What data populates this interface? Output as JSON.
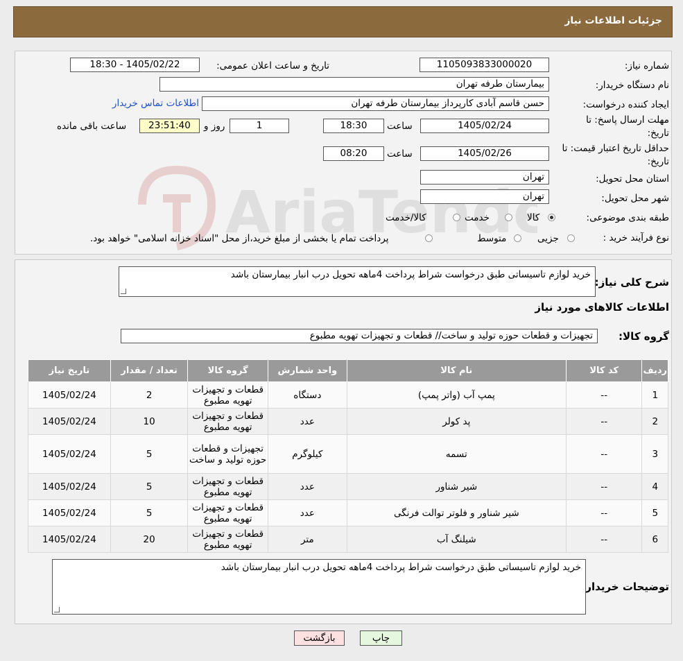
{
  "header": {
    "title": "جزئیات اطلاعات نیاز"
  },
  "info": {
    "need_number_label": "شماره نیاز:",
    "need_number": "1105093833000020",
    "announce_label": "تاریخ و ساعت اعلان عمومی:",
    "announce_value": "1405/02/22 - 18:30",
    "buyer_org_label": "نام دستگاه خریدار:",
    "buyer_org": "بیمارستان طرفه تهران",
    "creator_label": "ایجاد کننده درخواست:",
    "creator": "حسن قاسم آبادی کارپرداز بیمارستان طرفه تهران",
    "contact_link": "اطلاعات تماس خریدار",
    "deadline_label_1": "مهلت ارسال پاسخ: تا",
    "deadline_label_2": "تاریخ:",
    "deadline_date": "1405/02/24",
    "time_label": "ساعت",
    "deadline_time": "18:30",
    "days": "1",
    "days_label": "روز و",
    "remaining": "23:51:40",
    "remaining_label": "ساعت باقی مانده",
    "validity_label_1": "حداقل تاریخ اعتبار قیمت: تا",
    "validity_label_2": "تاریخ:",
    "validity_date": "1405/02/26",
    "validity_time": "08:20",
    "province_label": "استان محل تحویل:",
    "province": "تهران",
    "city_label": "شهر محل تحویل:",
    "city": "تهران",
    "category_label": "طبقه بندی موضوعی:",
    "category_options": [
      "کالا",
      "خدمت",
      "کالا/خدمت"
    ],
    "process_label": "نوع فرآیند خرید :",
    "process_options": [
      "جزیی",
      "متوسط"
    ],
    "process_note": "پرداخت تمام یا بخشی از مبلغ خرید،از محل \"اسناد خزانه اسلامی\" خواهد بود."
  },
  "description": {
    "label": "شرح کلی نیاز:",
    "text": "خرید لوازم تاسیساتی طبق درخواست شراط پرداخت 4ماهه تحویل درب انبار بیمارستان باشد"
  },
  "goods": {
    "section_title": "اطلاعات کالاهای مورد نیاز",
    "group_label": "گروه کالا:",
    "group_value": "تجهیزات و قطعات حوزه تولید و ساخت//  قطعات و تجهیزات تهویه مطبوع"
  },
  "table": {
    "headers": [
      "ردیف",
      "کد کالا",
      "نام کالا",
      "واحد شمارش",
      "گروه کالا",
      "تعداد / مقدار",
      "تاریخ نیاز"
    ],
    "rows": [
      [
        "1",
        "--",
        "پمپ آب (واتر پمپ)",
        "دستگاه",
        "قطعات و تجهیزات تهویه مطبوع",
        "2",
        "1405/02/24"
      ],
      [
        "2",
        "--",
        "پد کولر",
        "عدد",
        "قطعات و تجهیزات تهویه مطبوع",
        "10",
        "1405/02/24"
      ],
      [
        "3",
        "--",
        "تسمه",
        "کیلوگرم",
        "تجهیزات و قطعات حوزه تولید و ساخت",
        "5",
        "1405/02/24"
      ],
      [
        "4",
        "--",
        "شیر شناور",
        "عدد",
        "قطعات و تجهیزات تهویه مطبوع",
        "5",
        "1405/02/24"
      ],
      [
        "5",
        "--",
        "شیر شناور و فلوتر توالت فرنگی",
        "عدد",
        "قطعات و تجهیزات تهویه مطبوع",
        "5",
        "1405/02/24"
      ],
      [
        "6",
        "--",
        "شیلنگ آب",
        "متر",
        "قطعات و تجهیزات تهویه مطبوع",
        "20",
        "1405/02/24"
      ]
    ]
  },
  "buyer_notes": {
    "label": "توضیحات خریدار:",
    "text": "خرید لوازم تاسیساتی طبق درخواست شراط پرداخت 4ماهه تحویل درب انبار بیمارستان باشد"
  },
  "buttons": {
    "print": "چاپ",
    "back": "بازگشت"
  },
  "watermark": {
    "text": "AriaTender.neT"
  },
  "colors": {
    "header": "#8b6a3e",
    "table_header": "#9a9a9a",
    "back_button": "#fde0e0",
    "print_button": "#e6f7e0",
    "remaining_bg": "#ffffc8"
  }
}
